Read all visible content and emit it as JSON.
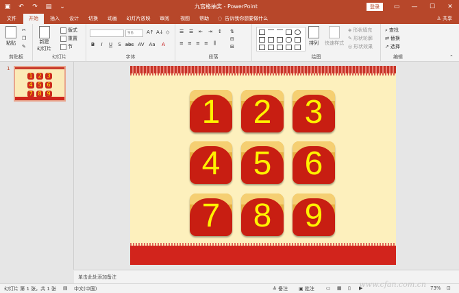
{
  "window": {
    "doc_title": "九宫格抽奖 - PowerPoint",
    "login_label": "登录"
  },
  "tabs": [
    "文件",
    "开始",
    "插入",
    "设计",
    "切换",
    "动画",
    "幻灯片放映",
    "审阅",
    "视图",
    "帮助"
  ],
  "tell_me": "告诉我你想要做什么",
  "share_label": "共享",
  "ribbon": {
    "clipboard": {
      "paste": "粘贴",
      "label": "剪贴板"
    },
    "slides": {
      "new_slide_l1": "新建",
      "new_slide_l2": "幻灯片",
      "layout": "版式",
      "reset": "重置",
      "section": "节",
      "label": "幻灯片"
    },
    "font": {
      "size": "96",
      "label": "字体",
      "buttons": [
        "B",
        "I",
        "U",
        "S",
        "abc",
        "AV",
        "Aa",
        "A"
      ]
    },
    "paragraph": {
      "label": "段落"
    },
    "drawing": {
      "arrange": "排列",
      "quick_styles": "快速样式",
      "fill": "形状填充",
      "outline": "形状轮廓",
      "effects": "形状效果",
      "label": "绘图"
    },
    "editing": {
      "find": "查找",
      "replace": "替换",
      "select": "选择",
      "label": "编辑"
    }
  },
  "thumbnail": {
    "index": "1"
  },
  "grid_numbers": [
    "1",
    "2",
    "3",
    "4",
    "5",
    "6",
    "7",
    "8",
    "9"
  ],
  "notes_placeholder": "单击此处添加备注",
  "status": {
    "slide_info": "幻灯片 第 1 张，共 1 张",
    "language": "中文(中国)",
    "notes": "备注",
    "comments": "批注",
    "zoom": "73%"
  },
  "watermark": "www.cfan.com.cn",
  "colors": {
    "accent": "#b7472a",
    "cell_red": "#c81e12",
    "number_yellow": "#fff200",
    "slide_bg": "#fdf0bd"
  }
}
